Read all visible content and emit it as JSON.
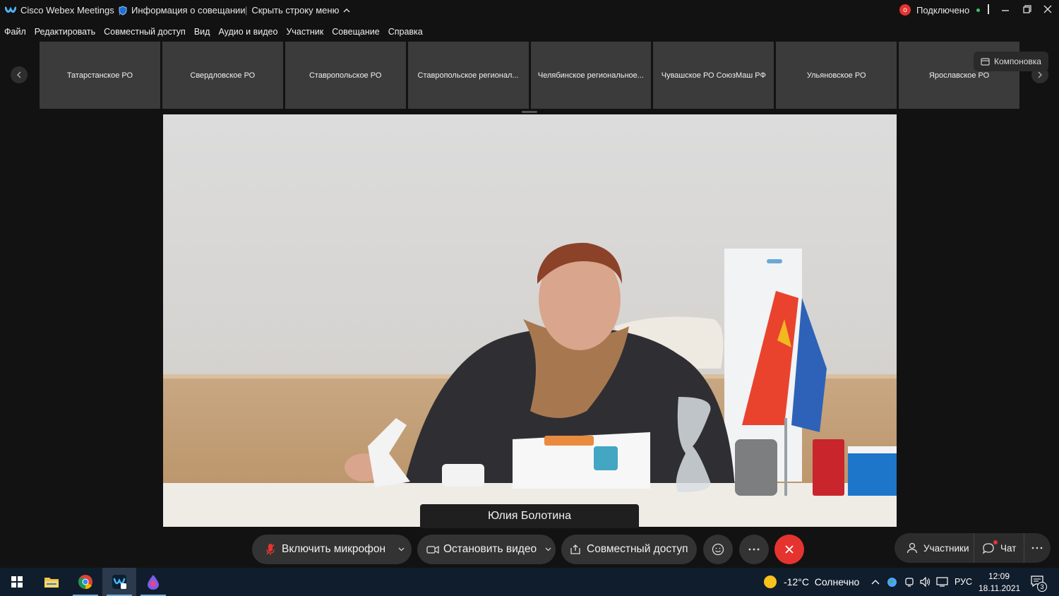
{
  "titlebar": {
    "app_name": "Cisco Webex Meetings",
    "meeting_info": "Информация о совещании",
    "hide_menu": "Скрыть строку меню",
    "status": "Подключено",
    "recording_badge": "o"
  },
  "menu": [
    "Файл",
    "Редактировать",
    "Совместный доступ",
    "Вид",
    "Аудио и видео",
    "Участник",
    "Совещание",
    "Справка"
  ],
  "filmstrip": {
    "participants": [
      "Татарстанское РО",
      "Свердловское РО",
      "Ставропольское РО",
      "Ставропольское регионал...",
      "Челябинское региональное...",
      "Чувашское РО СоюзМаш РФ",
      "Ульяновское РО",
      "Ярославское РО"
    ],
    "layout_label": "Компоновка"
  },
  "speaker": {
    "name": "Юлия Болотина"
  },
  "controls": {
    "unmute": "Включить микрофон",
    "stop_video": "Остановить видео",
    "share": "Совместный доступ",
    "participants": "Участники",
    "chat": "Чат"
  },
  "taskbar": {
    "weather": "-12°C  Солнечно",
    "lang": "РУС",
    "time": "12:09",
    "date": "18.11.2021",
    "notifications": "3"
  },
  "colors": {
    "end_button": "#e5342f",
    "status_dot": "#3cc26b",
    "record": "#e5342f"
  }
}
